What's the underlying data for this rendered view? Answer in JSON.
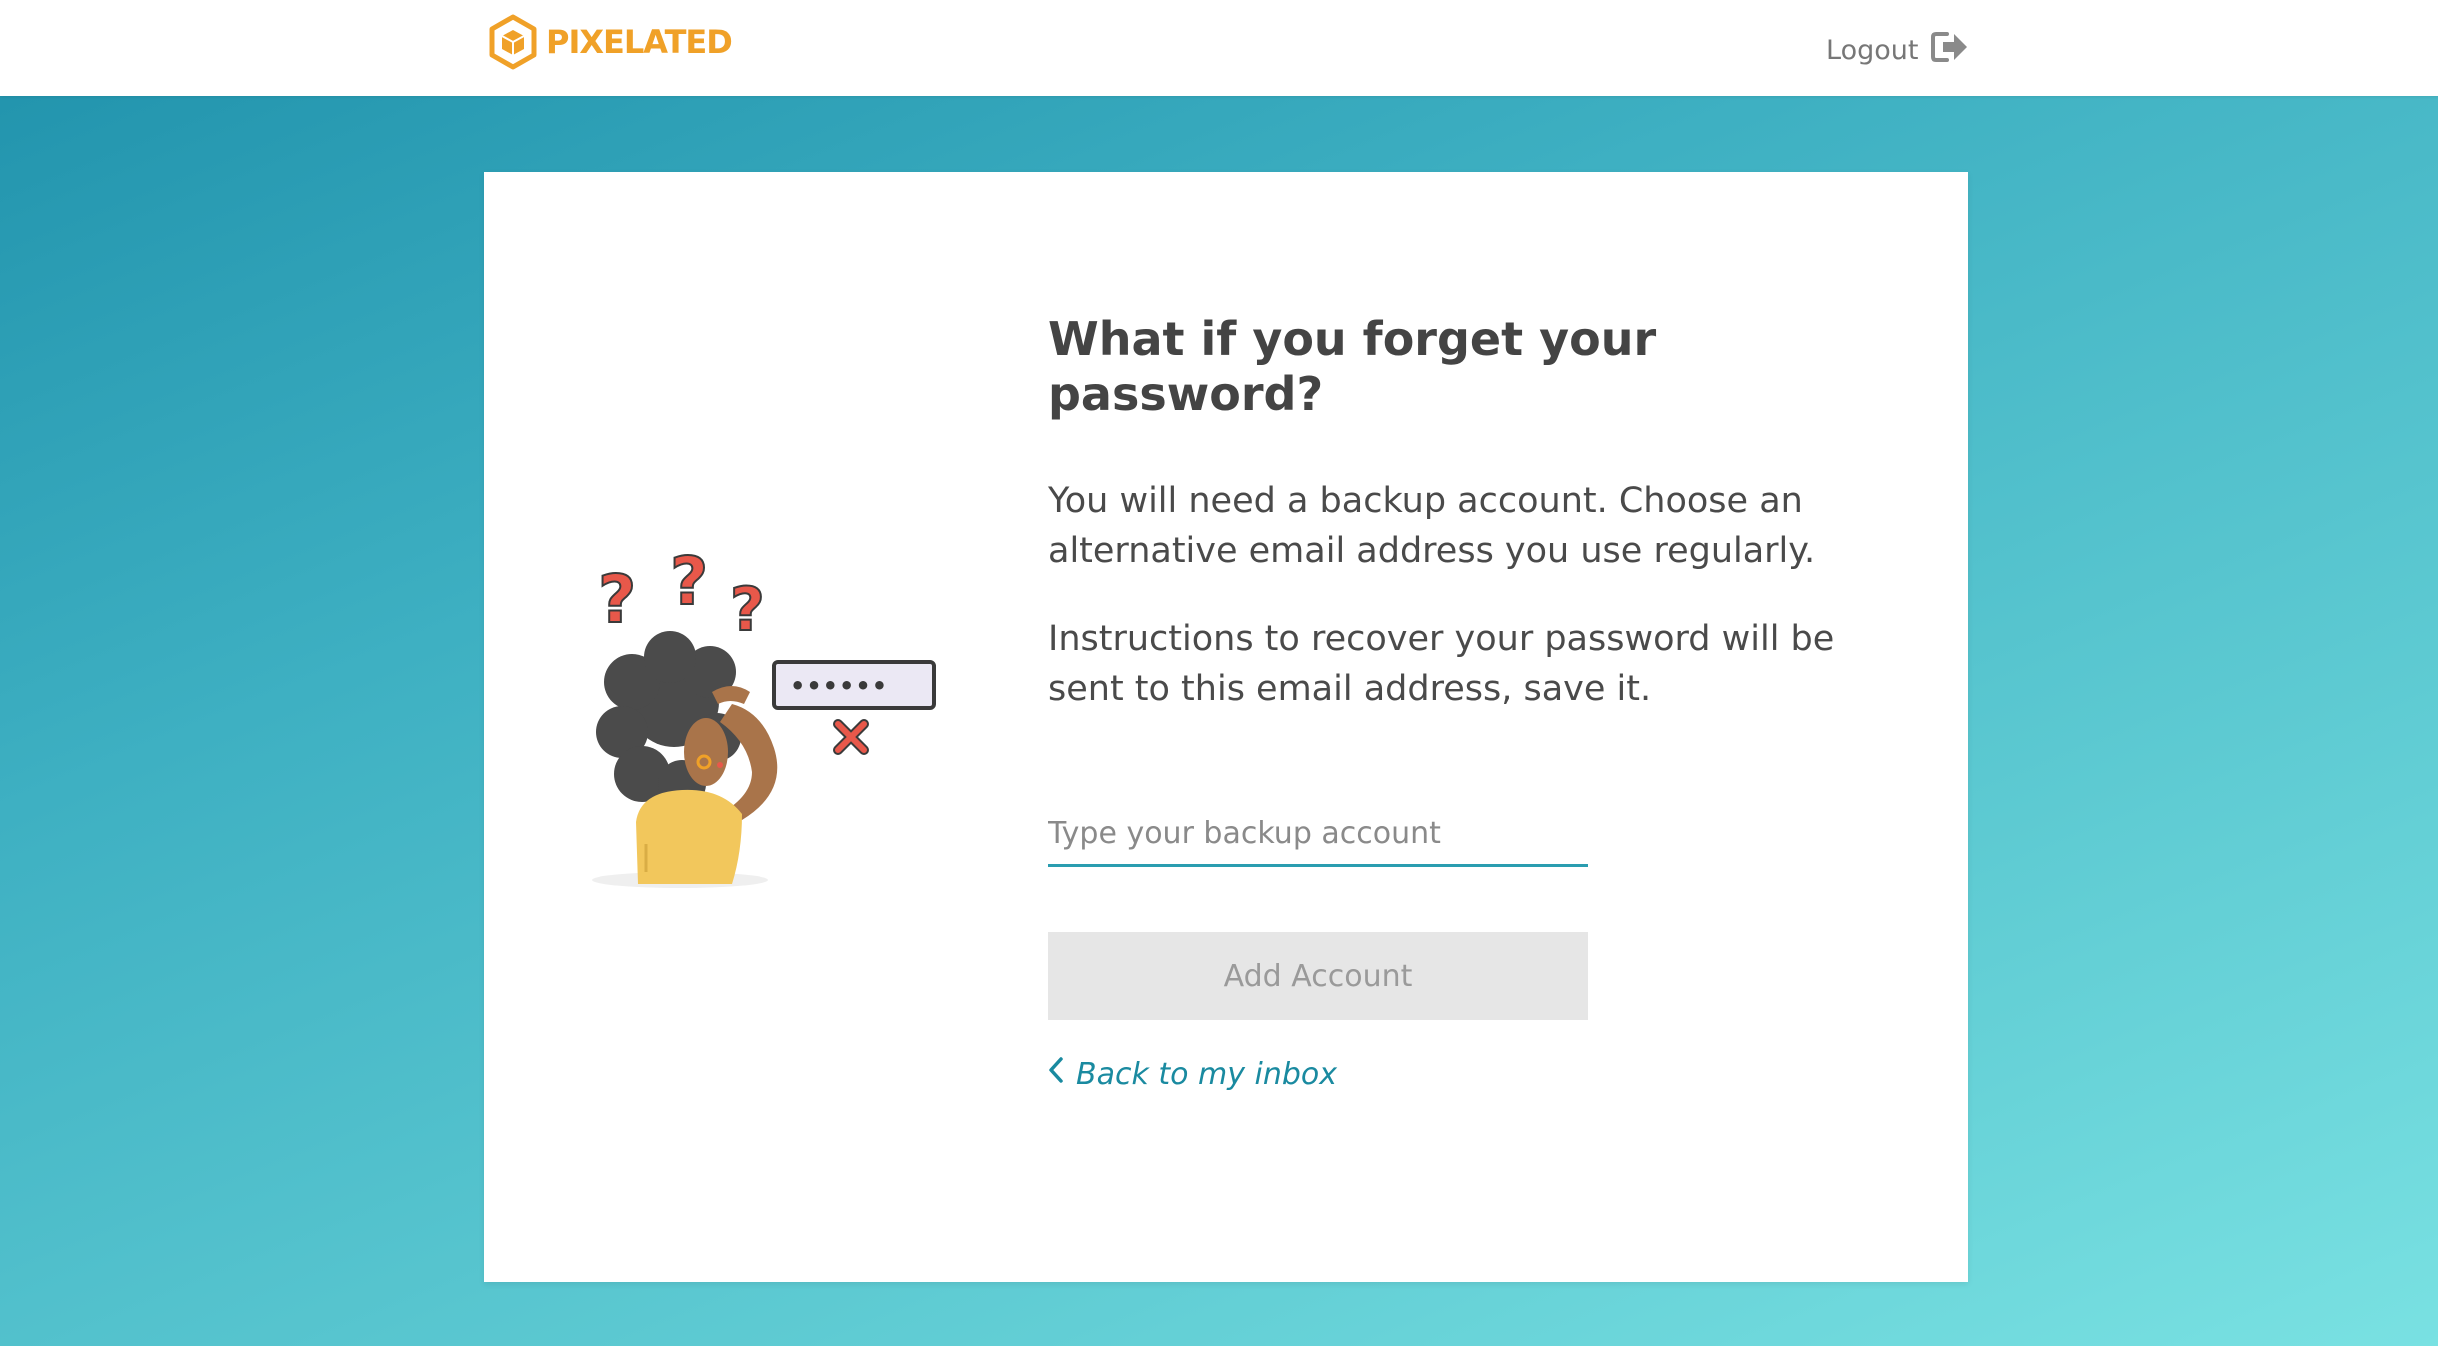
{
  "header": {
    "brand": "PIXELATED",
    "logout_label": "Logout",
    "logo_icon": "cube-logo-icon",
    "logout_icon": "logout-arrow-icon"
  },
  "card": {
    "title": "What if you forget your password?",
    "paragraph_1": "You will need a backup account. Choose an alternative email address you use regularly.",
    "paragraph_2": "Instructions to recover your password will be sent to this email address, save it.",
    "illustration": {
      "password_mask": "••••••"
    },
    "backup_input": {
      "value": "",
      "placeholder": "Type your backup account"
    },
    "add_button_label": "Add Account",
    "back_link_label": "Back to my inbox"
  },
  "colors": {
    "brand_orange": "#f0a128",
    "accent_teal": "#1a8aa0",
    "disabled_button": "#e6e6e6",
    "background_gradient_start": "#1f91ab",
    "background_gradient_end": "#79e1e2"
  }
}
